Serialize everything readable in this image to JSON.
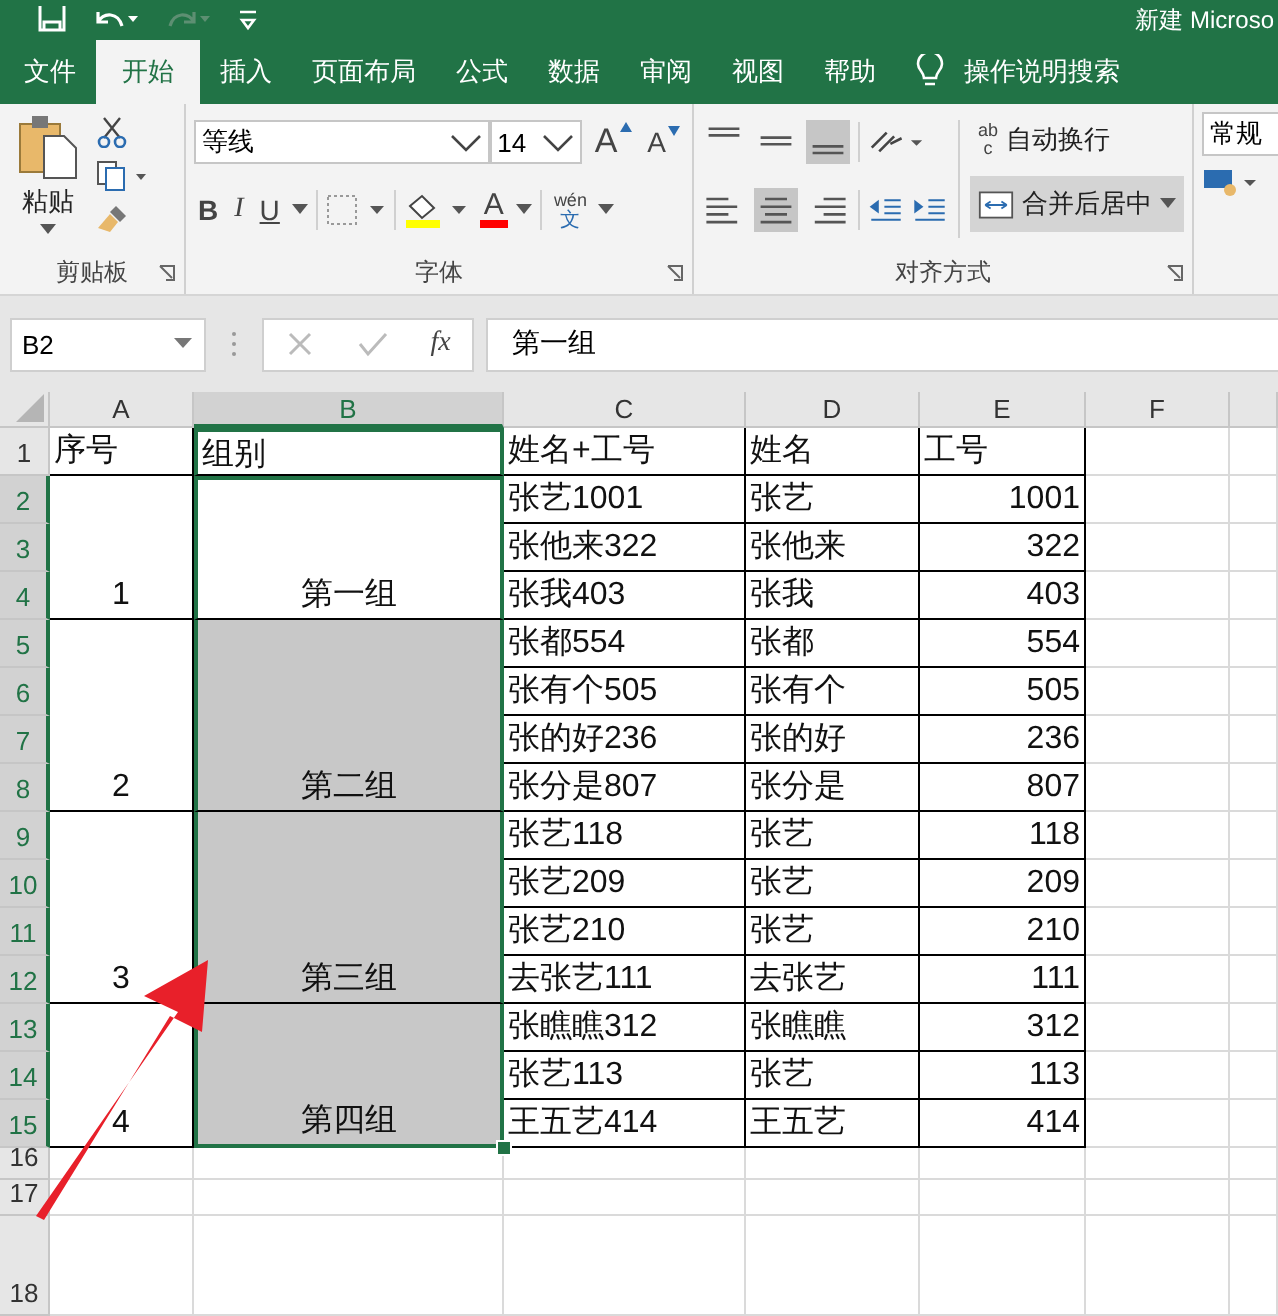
{
  "title_bar": {
    "title": "新建 Microso",
    "redo_disabled": true
  },
  "tabs": [
    {
      "label": "文件",
      "selected": false
    },
    {
      "label": "开始",
      "selected": true
    },
    {
      "label": "插入",
      "selected": false
    },
    {
      "label": "页面布局",
      "selected": false
    },
    {
      "label": "公式",
      "selected": false
    },
    {
      "label": "数据",
      "selected": false
    },
    {
      "label": "审阅",
      "selected": false
    },
    {
      "label": "视图",
      "selected": false
    },
    {
      "label": "帮助",
      "selected": false
    }
  ],
  "tell_me": "操作说明搜索",
  "ribbon": {
    "clipboard": {
      "paste": "粘贴",
      "label": "剪贴板"
    },
    "font": {
      "name": "等线",
      "size": "14",
      "grow": "A",
      "shrink": "A",
      "bold": "B",
      "italic": "I",
      "underline": "U",
      "font_color_letter": "A",
      "phonetic_top": "wén",
      "phonetic_bottom": "文",
      "label": "字体"
    },
    "alignment": {
      "vertical": [
        {
          "kind": "top",
          "selected": false
        },
        {
          "kind": "middle",
          "selected": false
        },
        {
          "kind": "bottom",
          "selected": true
        }
      ],
      "horizontal": [
        {
          "kind": "left",
          "selected": false
        },
        {
          "kind": "center",
          "selected": true
        },
        {
          "kind": "right",
          "selected": false
        }
      ],
      "wrap_icon_top": "ab",
      "wrap_icon_bottom": "c",
      "wrap_text": {
        "label": "自动换行",
        "on": false
      },
      "merge_center": {
        "label": "合并后居中",
        "on": true
      },
      "label": "对齐方式"
    },
    "number": {
      "format": "常规"
    }
  },
  "formula_bar": {
    "name_box": "B2",
    "fx": "fx",
    "value": "第一组"
  },
  "columns": [
    {
      "label": "A",
      "selected": false
    },
    {
      "label": "B",
      "selected": true
    },
    {
      "label": "C",
      "selected": false
    },
    {
      "label": "D",
      "selected": false
    },
    {
      "label": "E",
      "selected": false
    },
    {
      "label": "F",
      "selected": false
    }
  ],
  "row_headers": [
    {
      "label": "1",
      "selected": false
    },
    {
      "label": "2",
      "selected": true
    },
    {
      "label": "3",
      "selected": true
    },
    {
      "label": "4",
      "selected": true
    },
    {
      "label": "5",
      "selected": true
    },
    {
      "label": "6",
      "selected": true
    },
    {
      "label": "7",
      "selected": true
    },
    {
      "label": "8",
      "selected": true
    },
    {
      "label": "9",
      "selected": true
    },
    {
      "label": "10",
      "selected": true
    },
    {
      "label": "11",
      "selected": true
    },
    {
      "label": "12",
      "selected": true
    },
    {
      "label": "13",
      "selected": true
    },
    {
      "label": "14",
      "selected": true
    },
    {
      "label": "15",
      "selected": true
    },
    {
      "label": "16",
      "selected": false
    },
    {
      "label": "17",
      "selected": false
    },
    {
      "label": "18",
      "selected": false
    }
  ],
  "header": [
    "序号",
    "组别",
    "姓名+工号",
    "姓名",
    "工号"
  ],
  "groups": [
    {
      "number": "1",
      "name": "第一组",
      "active": true,
      "members": [
        {
          "full": "张艺1001",
          "name": "张艺",
          "id": "1001"
        },
        {
          "full": "张他来322",
          "name": "张他来",
          "id": "322"
        },
        {
          "full": "张我403",
          "name": "张我",
          "id": "403"
        }
      ]
    },
    {
      "number": "2",
      "name": "第二组",
      "active": false,
      "members": [
        {
          "full": "张都554",
          "name": "张都",
          "id": "554"
        },
        {
          "full": "张有个505",
          "name": "张有个",
          "id": "505"
        },
        {
          "full": "张的好236",
          "name": "张的好",
          "id": "236"
        },
        {
          "full": "张分是807",
          "name": "张分是",
          "id": "807"
        }
      ]
    },
    {
      "number": "3",
      "name": "第三组",
      "active": false,
      "members": [
        {
          "full": "张艺118",
          "name": "张艺",
          "id": "118"
        },
        {
          "full": "张艺209",
          "name": "张艺",
          "id": "209"
        },
        {
          "full": "张艺210",
          "name": "张艺",
          "id": "210"
        },
        {
          "full": "去张艺111",
          "name": "去张艺",
          "id": "111"
        }
      ]
    },
    {
      "number": "4",
      "name": "第四组",
      "active": false,
      "members": [
        {
          "full": "张瞧瞧312",
          "name": "张瞧瞧",
          "id": "312"
        },
        {
          "full": "张艺113",
          "name": "张艺",
          "id": "113"
        },
        {
          "full": "王五艺414",
          "name": "王五艺",
          "id": "414"
        }
      ]
    }
  ]
}
